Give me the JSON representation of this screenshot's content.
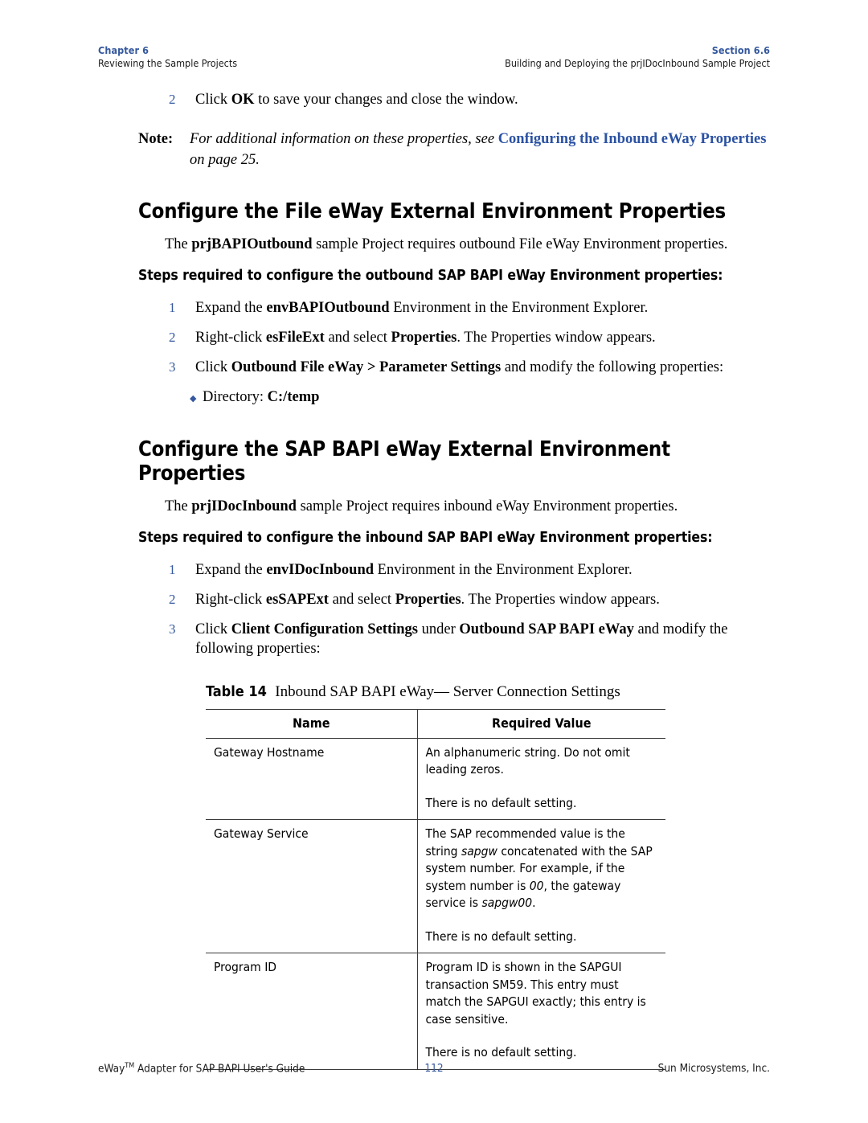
{
  "header": {
    "left_tag": "Chapter 6",
    "left_sub": "Reviewing the Sample Projects",
    "right_tag": "Section 6.6",
    "right_sub": "Building and Deploying the prjIDocInbound Sample Project"
  },
  "top_step": {
    "num": "2",
    "pre": "Click ",
    "bold": "OK",
    "post": " to save your changes and close the window."
  },
  "note": {
    "label": "Note:",
    "pre": "For additional information on these properties, see ",
    "link": "Configuring the Inbound eWay Properties",
    "post": " on page 25."
  },
  "section1": {
    "heading": "Configure the File eWay External Environment Properties",
    "para_pre": "The ",
    "para_bold": "prjBAPIOutbound",
    "para_post": " sample Project requires outbound File eWay Environment properties.",
    "lead": "Steps required to configure the outbound SAP BAPI eWay Environment properties:",
    "steps": [
      {
        "num": "1",
        "pre": "Expand the ",
        "bold": "envBAPIOutbound",
        "post": " Environment in the Environment Explorer."
      },
      {
        "num": "2",
        "pre": "Right-click ",
        "bold": "esFileExt",
        "mid": " and select ",
        "bold2": "Properties",
        "post": ". The Properties window appears."
      },
      {
        "num": "3",
        "pre": "Click ",
        "bold": "Outbound File eWay > Parameter Settings",
        "post": " and modify the following properties:"
      }
    ],
    "bullet": {
      "marker": "diamond-bullet",
      "label": "Directory: ",
      "value": "C:/temp"
    }
  },
  "section2": {
    "heading": "Configure the SAP BAPI eWay External Environment Properties",
    "para_pre": "The ",
    "para_bold": "prjIDocInbound",
    "para_post": " sample Project requires inbound eWay Environment properties.",
    "lead": "Steps required to configure the inbound SAP BAPI eWay Environment properties:",
    "steps": [
      {
        "num": "1",
        "pre": "Expand the ",
        "bold": "envIDocInbound",
        "post": " Environment in the Environment Explorer."
      },
      {
        "num": "2",
        "pre": "Right-click ",
        "bold": "esSAPExt",
        "mid": " and select ",
        "bold2": "Properties",
        "post": ". The Properties window appears."
      },
      {
        "num": "3",
        "pre": "Click ",
        "bold": "Client Configuration Settings",
        "mid": " under ",
        "bold2": "Outbound SAP BAPI eWay",
        "post": " and modify the following properties:"
      }
    ]
  },
  "table": {
    "caption_number": "Table 14",
    "caption_title": "Inbound SAP BAPI eWay— Server Connection Settings",
    "columns": [
      "Name",
      "Required Value"
    ],
    "rows": [
      {
        "name": "Gateway Hostname",
        "value_main": "An alphanumeric string. Do not omit leading zeros.",
        "value_default": "There is no default setting."
      },
      {
        "name": "Gateway Service",
        "value_p1": "The SAP recommended value is the string ",
        "value_i1": "sapgw",
        "value_p2": " concatenated with the SAP system number. For example, if the system number is ",
        "value_i2": "00",
        "value_p3": ", the gateway service is ",
        "value_i3": "sapgw00",
        "value_p4": ".",
        "value_default": "There is no default setting."
      },
      {
        "name": "Program ID",
        "value_main": "Program ID is shown in the SAPGUI transaction SM59. This entry must match the SAPGUI exactly; this entry is case sensitive.",
        "value_default": "There is no default setting."
      }
    ]
  },
  "footer": {
    "left_pre": "eWay",
    "left_tm": "TM",
    "left_post": " Adapter for SAP BAPI User's Guide",
    "page": "112",
    "right": "Sun Microsystems, Inc."
  },
  "colors": {
    "accent_blue": "#35589E",
    "link_blue": "#2B52A3",
    "rule": "#3a3a3a"
  }
}
